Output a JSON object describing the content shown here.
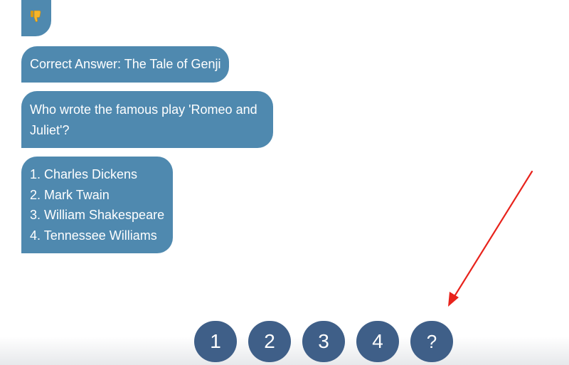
{
  "chat": {
    "feedback_icon": "thumbs-down-icon",
    "correct_answer": "Correct Answer: The Tale of Genji",
    "question": "Who wrote the famous play 'Romeo and Juliet'?",
    "options": [
      "1. Charles Dickens",
      "2. Mark Twain",
      "3. William Shakespeare",
      "4. Tennessee Williams"
    ]
  },
  "quick_replies": [
    "1",
    "2",
    "3",
    "4",
    "?"
  ],
  "colors": {
    "bot_bubble": "#4f89af",
    "quick_reply": "#3f5f88",
    "annotation_arrow": "#e8231c",
    "thumbs_down": "#f4b400"
  }
}
